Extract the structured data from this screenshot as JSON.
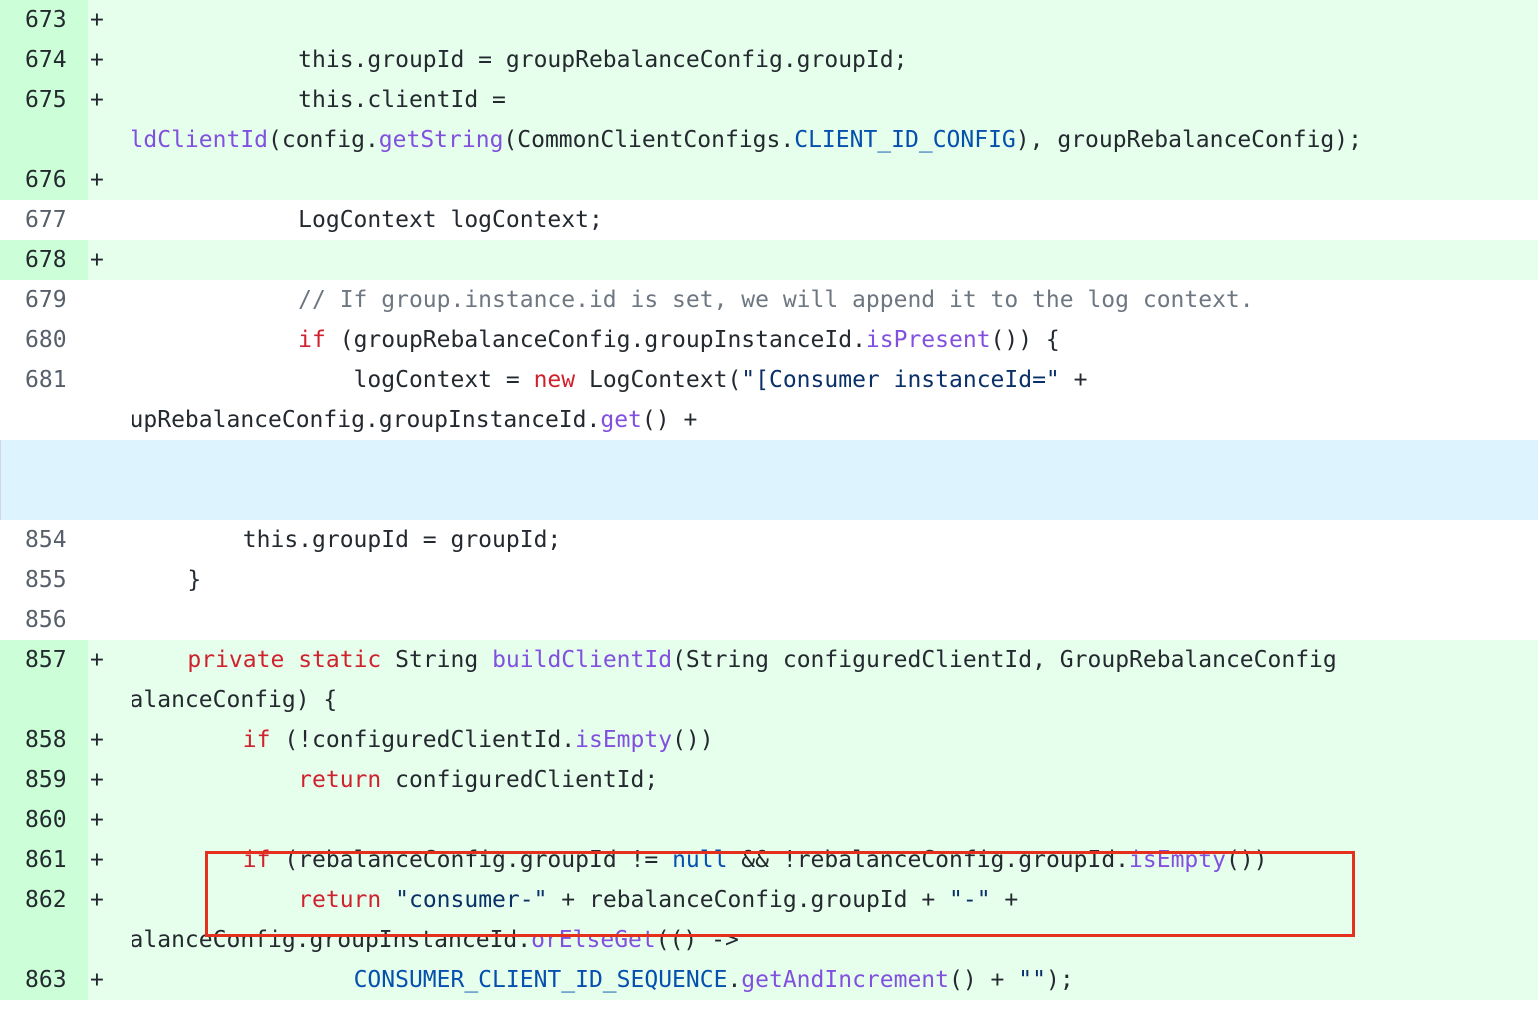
{
  "diff": {
    "sign_add": "+",
    "lines": [
      {
        "num": "673"
      },
      {
        "num": "674",
        "t1": "            this.groupId = groupRebalanceConfig.groupId;"
      },
      {
        "num": "675",
        "t1": "            this.clientId =",
        "t2a": "buildClientId",
        "t2b": "(config.",
        "t2c": "getString",
        "t2d": "(CommonClientConfigs.",
        "t2e": "CLIENT_ID_CONFIG",
        "t2f": "), groupRebalanceConfig);"
      },
      {
        "num": "676"
      },
      {
        "num": "677",
        "t1": "            LogContext logContext;"
      },
      {
        "num": "678"
      },
      {
        "num": "679",
        "t1": "            // If group.instance.id is set, we will append it to the log context."
      },
      {
        "num": "680",
        "ind": "            ",
        "kw": "if",
        "t1": " (groupRebalanceConfig.groupInstanceId.",
        "fn": "isPresent",
        "t2": "()) {"
      },
      {
        "num": "681",
        "ind": "                logContext = ",
        "kw": "new",
        "t1": " LogContext(",
        "str": "\"[Consumer instanceId=\"",
        "t2": " +",
        "c1": "groupRebalanceConfig.groupInstanceId.",
        "c2": "get",
        "c3": "() +"
      },
      {
        "num": "854",
        "t1": "        this.groupId = groupId;"
      },
      {
        "num": "855",
        "t1": "    }"
      },
      {
        "num": "856"
      },
      {
        "num": "857",
        "ind": "    ",
        "kw1": "private",
        "kw2": "static",
        "t1": " String ",
        "fn": "buildClientId",
        "t2": "(String configuredClientId, GroupRebalanceConfig",
        "c1": "rebalanceConfig) {"
      },
      {
        "num": "858",
        "ind": "        ",
        "kw": "if",
        "t1": " (!configuredClientId.",
        "fn": "isEmpty",
        "t2": "())"
      },
      {
        "num": "859",
        "ind": "            ",
        "kw": "return",
        "t1": " configuredClientId;"
      },
      {
        "num": "860"
      },
      {
        "num": "861",
        "ind": "        ",
        "kw": "if",
        "t1": " (rebalanceConfig.groupId != ",
        "cst": "null",
        "t2": " && !rebalanceConfig.groupId.",
        "fn": "isEmpty",
        "t3": "())"
      },
      {
        "num": "862",
        "ind": "            ",
        "kw": "return",
        "str1": "\"consumer-\"",
        "t1": " + rebalanceConfig.groupId + ",
        "str2": "\"-\"",
        "t2": " +",
        "c1": "rebalanceConfig.groupInstanceId.",
        "c2": "orElseGet",
        "c3": "(() ->"
      },
      {
        "num": "863",
        "ind": "                ",
        "cst": "CONSUMER_CLIENT_ID_SEQUENCE",
        "t1": ".",
        "fn": "getAndIncrement",
        "t2": "() + ",
        "str": "\"\"",
        "t3": ");"
      }
    ]
  }
}
